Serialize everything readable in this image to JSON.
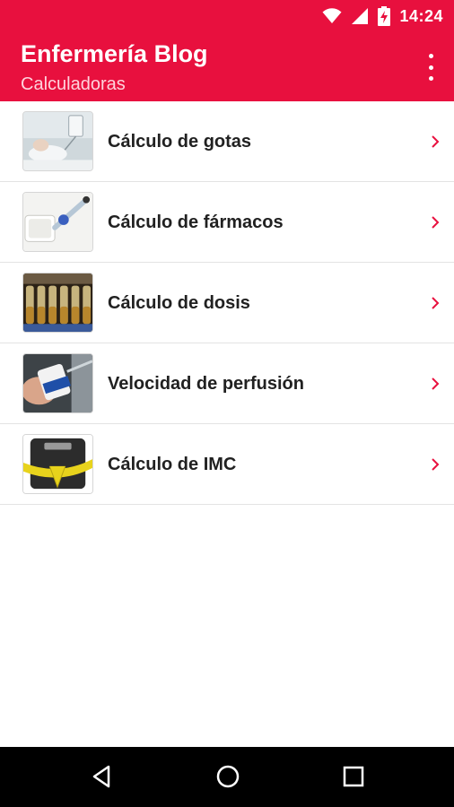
{
  "status_bar": {
    "time": "14:24",
    "icons": [
      "wifi-icon",
      "signal-icon",
      "battery-charging-icon"
    ],
    "color": "#e8103e"
  },
  "toolbar": {
    "title": "Enfermería Blog",
    "subtitle": "Calculadoras",
    "overflow_icon": "more-vert-icon",
    "color": "#e8103e"
  },
  "list": {
    "items": [
      {
        "label": "Cálculo de gotas",
        "thumb": "iv-drip-photo"
      },
      {
        "label": "Cálculo de fármacos",
        "thumb": "syringe-vial-photo"
      },
      {
        "label": "Cálculo de dosis",
        "thumb": "ampoules-photo"
      },
      {
        "label": "Velocidad de perfusión",
        "thumb": "flow-regulator-photo"
      },
      {
        "label": "Cálculo de IMC",
        "thumb": "scale-tape-photo"
      }
    ],
    "chevron_icon": "chevron-right-icon",
    "chevron_color": "#e8103e"
  },
  "nav_bar": {
    "buttons": [
      "back-icon",
      "home-icon",
      "recent-apps-icon"
    ]
  }
}
